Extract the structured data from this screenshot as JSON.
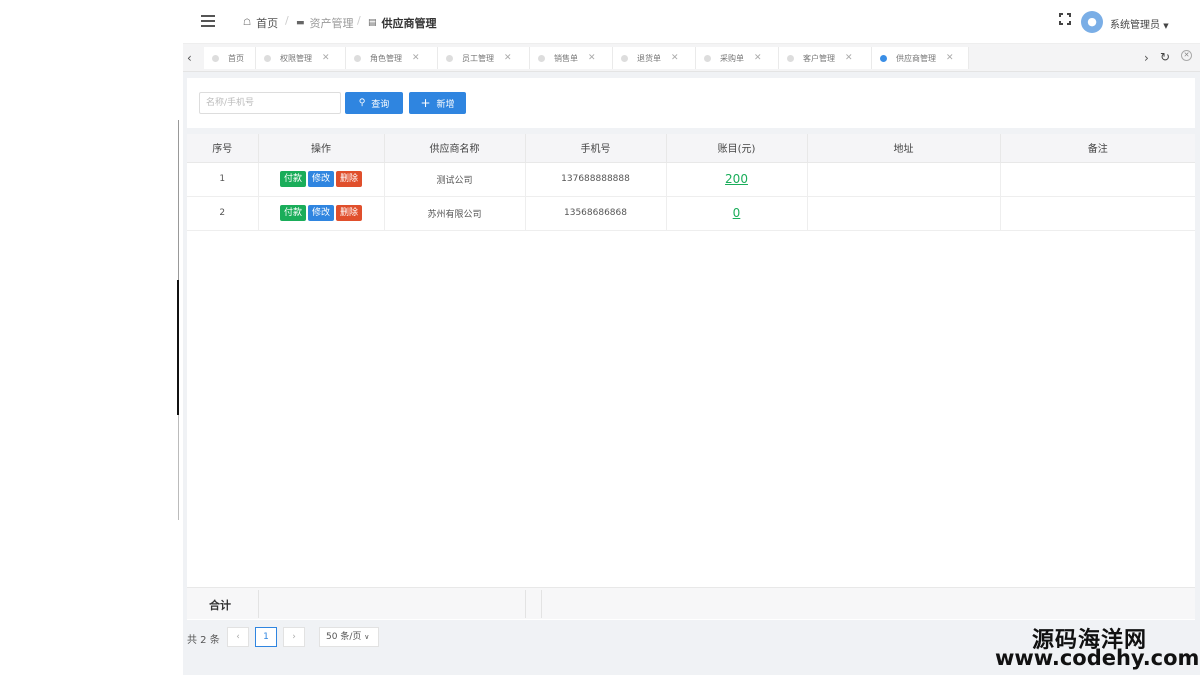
{
  "header": {
    "breadcrumb": [
      "首页",
      "资产管理",
      "供应商管理"
    ],
    "username": "系统管理员"
  },
  "tabs": [
    {
      "label": "首页",
      "closable": false,
      "active": false
    },
    {
      "label": "权限管理",
      "closable": true,
      "active": false
    },
    {
      "label": "角色管理",
      "closable": true,
      "active": false
    },
    {
      "label": "员工管理",
      "closable": true,
      "active": false
    },
    {
      "label": "销售单",
      "closable": true,
      "active": false
    },
    {
      "label": "退货单",
      "closable": true,
      "active": false
    },
    {
      "label": "采购单",
      "closable": true,
      "active": false
    },
    {
      "label": "客户管理",
      "closable": true,
      "active": false
    },
    {
      "label": "供应商管理",
      "closable": true,
      "active": true
    }
  ],
  "search": {
    "placeholder": "名称/手机号",
    "query_label": "查询",
    "add_label": "新增"
  },
  "table": {
    "columns": [
      "序号",
      "操作",
      "供应商名称",
      "手机号",
      "账目(元)",
      "地址",
      "备注"
    ],
    "actions": {
      "pay": "付款",
      "edit": "修改",
      "delete": "删除"
    },
    "rows": [
      {
        "index": "1",
        "name": "测试公司",
        "phone": "137688888888",
        "amount": "200",
        "address": "",
        "remark": ""
      },
      {
        "index": "2",
        "name": "苏州有限公司",
        "phone": "13568686868",
        "amount": "0",
        "address": "",
        "remark": ""
      }
    ],
    "sum_label": "合计"
  },
  "pagination": {
    "total_text": "共 2 条",
    "current_page": "1",
    "page_size": "50 条/页"
  },
  "watermark": {
    "line1": "源码海洋网",
    "line2": "www.codehy.com"
  },
  "colors": {
    "primary": "#2f85e0",
    "pay": "#1aad5a",
    "delete": "#e04f2c"
  },
  "icons": [
    "menu-icon",
    "home-icon",
    "folder-icon",
    "list-icon",
    "fullscreen-icon",
    "user-icon",
    "caret-down-icon",
    "chevron-left-icon",
    "chevron-right-icon",
    "refresh-icon",
    "close-circle-icon",
    "search-icon",
    "plus-icon"
  ]
}
